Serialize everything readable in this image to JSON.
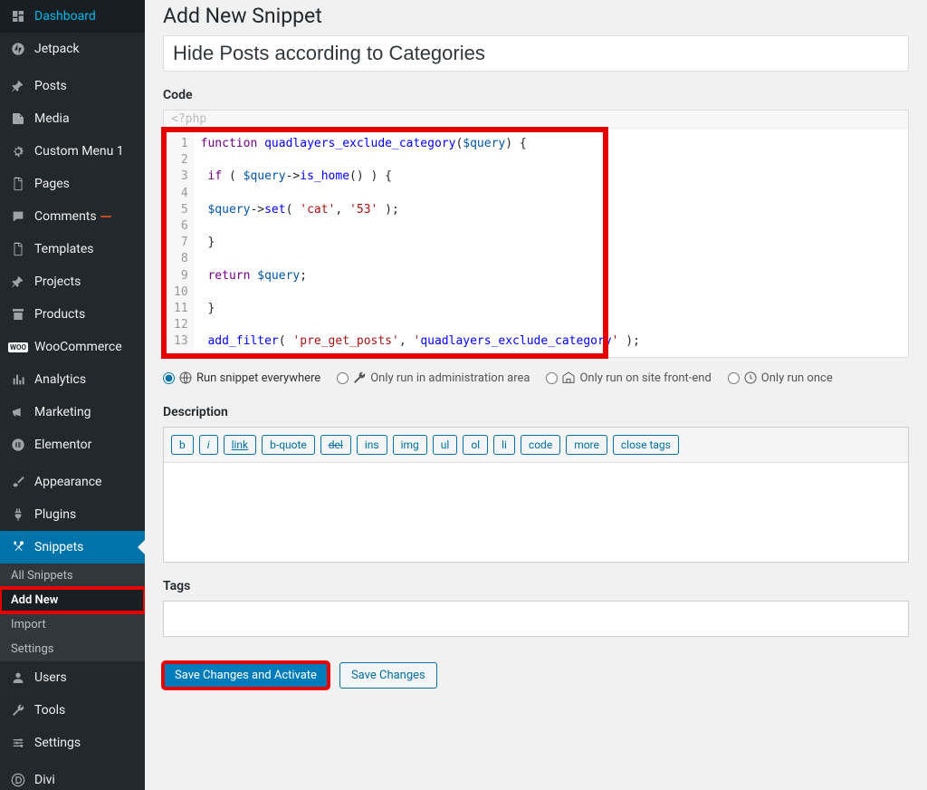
{
  "sidebar": {
    "items": [
      {
        "icon": "dashboard",
        "label": "Dashboard"
      },
      {
        "icon": "jetpack",
        "label": "Jetpack"
      },
      {
        "type": "sep"
      },
      {
        "icon": "pin",
        "label": "Posts"
      },
      {
        "icon": "media",
        "label": "Media"
      },
      {
        "icon": "gear",
        "label": "Custom Menu 1"
      },
      {
        "icon": "page",
        "label": "Pages"
      },
      {
        "icon": "comment",
        "label": "Comments",
        "badge": ""
      },
      {
        "icon": "page",
        "label": "Templates"
      },
      {
        "icon": "pin",
        "label": "Projects"
      },
      {
        "icon": "archive",
        "label": "Products"
      },
      {
        "icon": "woo",
        "label": "WooCommerce"
      },
      {
        "icon": "analytics",
        "label": "Analytics"
      },
      {
        "icon": "megaphone",
        "label": "Marketing"
      },
      {
        "icon": "elementor",
        "label": "Elementor"
      },
      {
        "type": "sep"
      },
      {
        "icon": "brush",
        "label": "Appearance"
      },
      {
        "icon": "plug",
        "label": "Plugins"
      },
      {
        "icon": "snippets",
        "label": "Snippets",
        "active": true,
        "submenu": [
          "All Snippets",
          "Add New",
          "Import",
          "Settings"
        ],
        "current_sub": 1
      },
      {
        "icon": "user",
        "label": "Users"
      },
      {
        "icon": "wrench",
        "label": "Tools"
      },
      {
        "icon": "sliders",
        "label": "Settings"
      },
      {
        "type": "sep"
      },
      {
        "icon": "divi",
        "label": "Divi"
      }
    ]
  },
  "page": {
    "title": "Add New Snippet",
    "snippet_title": "Hide Posts according to Categories",
    "code_label": "Code",
    "php_hint": "<?php",
    "code_lines": [
      {
        "n": 1,
        "t": "function quadlayers_exclude_category($query) {"
      },
      {
        "n": 2,
        "t": ""
      },
      {
        "n": 3,
        "t": " if ( $query->is_home() ) {"
      },
      {
        "n": 4,
        "t": ""
      },
      {
        "n": 5,
        "t": " $query->set( 'cat', '53' );"
      },
      {
        "n": 6,
        "t": ""
      },
      {
        "n": 7,
        "t": " }"
      },
      {
        "n": 8,
        "t": ""
      },
      {
        "n": 9,
        "t": " return $query;"
      },
      {
        "n": 10,
        "t": ""
      },
      {
        "n": 11,
        "t": " }"
      },
      {
        "n": 12,
        "t": ""
      },
      {
        "n": 13,
        "t": " add_filter( 'pre_get_posts', 'quadlayers_exclude_category' );"
      }
    ],
    "radios": [
      {
        "label": "Run snippet everywhere",
        "icon": "globe",
        "checked": true
      },
      {
        "label": "Only run in administration area",
        "icon": "wrench"
      },
      {
        "label": "Only run on site front-end",
        "icon": "site"
      },
      {
        "label": "Only run once",
        "icon": "clock"
      }
    ],
    "desc_label": "Description",
    "quicktags": [
      {
        "label": "b"
      },
      {
        "label": "i",
        "style": "i"
      },
      {
        "label": "link",
        "style": "u"
      },
      {
        "label": "b-quote"
      },
      {
        "label": "del",
        "style": "s"
      },
      {
        "label": "ins"
      },
      {
        "label": "img"
      },
      {
        "label": "ul"
      },
      {
        "label": "ol"
      },
      {
        "label": "li"
      },
      {
        "label": "code"
      },
      {
        "label": "more"
      },
      {
        "label": "close tags"
      }
    ],
    "tags_label": "Tags",
    "buttons": {
      "primary": "Save Changes and Activate",
      "secondary": "Save Changes"
    }
  }
}
